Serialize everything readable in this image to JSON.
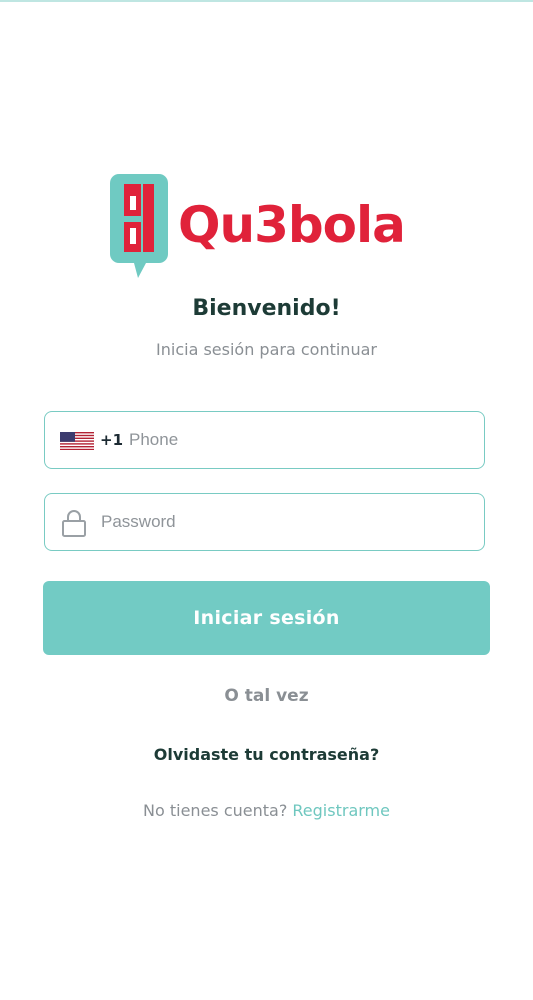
{
  "app": {
    "brand_name": "Qu3bola",
    "brand_color": "#e0223a",
    "accent_color": "#72cbc4"
  },
  "login": {
    "welcome_title": "Bienvenido!",
    "subtitle": "Inicia sesión para continuar",
    "phone": {
      "country_flag_icon": "us-flag-icon",
      "country_code": "+1",
      "placeholder": "Phone",
      "value": ""
    },
    "password": {
      "icon": "lock-icon",
      "placeholder": "Password",
      "value": ""
    },
    "submit_label": "Iniciar sesión",
    "alternative_label": "O tal vez",
    "forgot_password_label": "Olvidaste tu contraseña?",
    "no_account_prompt": "No tienes cuenta?",
    "register_link_label": "Registrarme"
  }
}
